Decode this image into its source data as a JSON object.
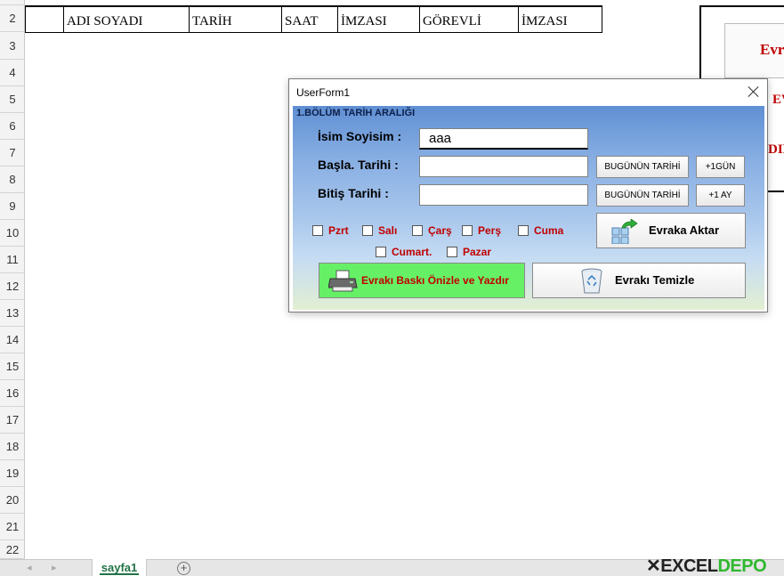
{
  "sheet": {
    "row_numbers": [
      "2",
      "3",
      "4",
      "5",
      "6",
      "7",
      "8",
      "9",
      "10",
      "11",
      "12",
      "13",
      "14",
      "15",
      "16",
      "17",
      "18",
      "19",
      "20",
      "21",
      "22"
    ],
    "headers": [
      "ADI SOYADI",
      "TARİH",
      "SAAT",
      "İMZASI",
      "GÖREVLİ",
      "İMZASI"
    ],
    "right_box": {
      "line1": "Evr",
      "line2": "EV",
      "line3": "DIR"
    },
    "tab_label": "sayfa1",
    "add_sheet": "+",
    "logo": {
      "part1": "EXCEL",
      "part2": "DEPO"
    }
  },
  "form": {
    "title": "UserForm1",
    "section_label": "1.BÖLÜM TARİH ARALIĞI",
    "name_label": "İsim Soyisim :",
    "name_value": "aaa",
    "start_label": "Başla. Tarihi  :",
    "start_value": "",
    "end_label": "Bitiş   Tarihi  :",
    "end_value": "",
    "today_button_1": "BUGÜNÜN TARİHİ",
    "plus_day_button": "+1GÜN",
    "today_button_2": "BUGÜNÜN TARİHİ",
    "plus_month_button": "+1 AY",
    "days": [
      "Pzrt",
      "Salı",
      "Çarş",
      "Perş",
      "Cuma",
      "Cumart.",
      "Pazar"
    ],
    "transfer_button": "Evraka Aktar",
    "print_button": "Evrakı Baskı Önizle ve Yazdır",
    "clear_button": "Evrakı Temizle"
  },
  "colors": {
    "accent_green": "#217346",
    "day_label_red": "#c00000",
    "print_button_bg": "#66f066",
    "logo_green": "#2fb82f"
  },
  "icons": [
    "printer-icon",
    "recycle-bin-icon",
    "transfer-icon",
    "close-icon",
    "add-sheet-icon"
  ]
}
